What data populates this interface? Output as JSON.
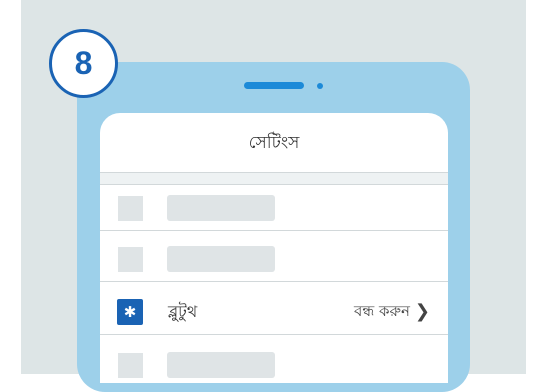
{
  "step": {
    "number": "8"
  },
  "settings": {
    "title": "সেটিংস",
    "bluetooth": {
      "icon": "bluetooth-icon",
      "glyph": "✱",
      "label": "ব্লুটুথ",
      "status": "বন্ধ করুন",
      "chevron": "❯"
    }
  },
  "colors": {
    "background": "#dde5e6",
    "phone_body": "#9dd0ea",
    "accent": "#1a63b4",
    "placeholder": "#dfe4e6"
  }
}
